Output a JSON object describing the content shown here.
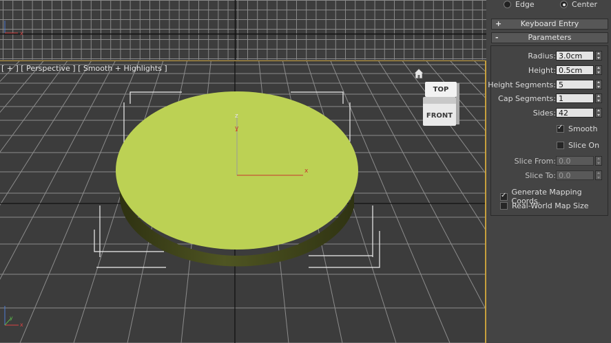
{
  "top_viewport": {
    "axis_labels": {
      "x": "x",
      "y": "y"
    }
  },
  "perspective_viewport": {
    "label": "[ + ] [ Perspective ] [ Smooth + Highlights ]",
    "gizmo_labels": {
      "z": "z",
      "y": "y",
      "x": "x"
    },
    "corner_axis": {
      "x": "x",
      "y": "y"
    },
    "view_cube": {
      "top": "TOP",
      "front": "FRONT"
    },
    "object_color": "#bcd154",
    "grid_color": "#8c8c8c",
    "border_color": "#c8a03c"
  },
  "command_panel": {
    "pivot_options": [
      {
        "label": "Edge",
        "selected": false
      },
      {
        "label": "Center",
        "selected": true
      }
    ],
    "rollouts": {
      "keyboard_entry": {
        "sign": "+",
        "title": "Keyboard Entry"
      },
      "parameters": {
        "sign": "-",
        "title": "Parameters"
      }
    },
    "parameters": {
      "radius": {
        "label": "Radius:",
        "value": "3.0cm"
      },
      "height": {
        "label": "Height:",
        "value": "0.5cm"
      },
      "height_segments": {
        "label": "Height Segments:",
        "value": "5"
      },
      "cap_segments": {
        "label": "Cap Segments:",
        "value": "1"
      },
      "sides": {
        "label": "Sides:",
        "value": "42"
      },
      "smooth": {
        "label": "Smooth",
        "checked": true
      },
      "slice_on": {
        "label": "Slice On",
        "checked": false
      },
      "slice_from": {
        "label": "Slice From:",
        "value": "0.0"
      },
      "slice_to": {
        "label": "Slice To:",
        "value": "0.0"
      },
      "generate_mapping": {
        "label": "Generate Mapping Coords.",
        "checked": true
      },
      "real_world_map": {
        "label": "Real-World Map Size",
        "checked": false
      }
    }
  }
}
